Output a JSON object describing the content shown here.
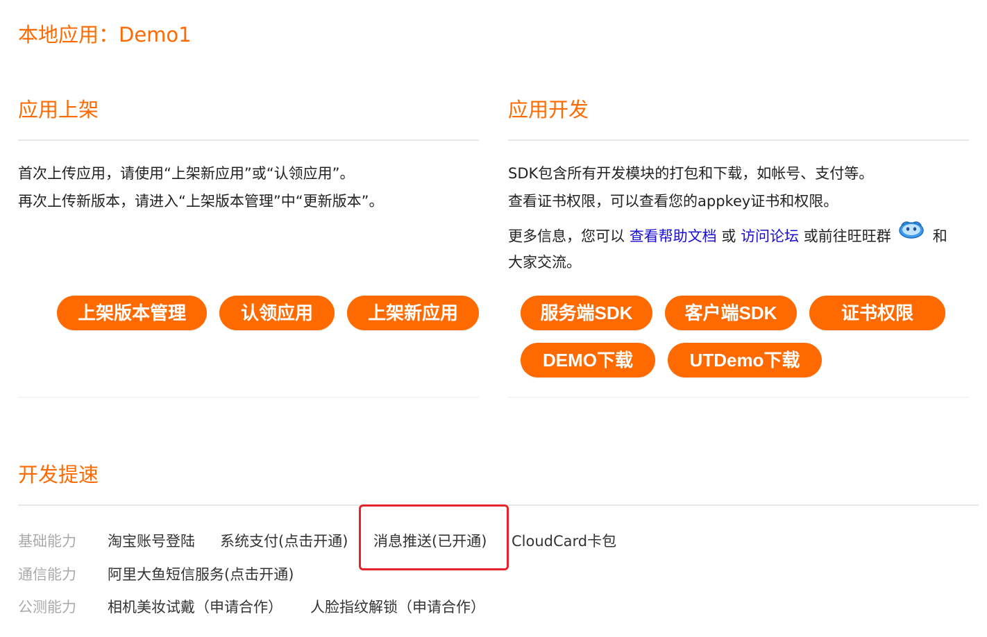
{
  "page": {
    "title": "本地应用：Demo1"
  },
  "listing": {
    "title": "应用上架",
    "line1": "首次上传应用，请使用“上架新应用”或“认领应用”。",
    "line2": "再次上传新版本，请进入“上架版本管理”中“更新版本”。",
    "buttons": [
      "上架版本管理",
      "认领应用",
      "上架新应用"
    ]
  },
  "development": {
    "title": "应用开发",
    "line1": "SDK包含所有开发模块的打包和下载，如帐号、支付等。",
    "line2": "查看证书权限，可以查看您的appkey证书和权限。",
    "more_prefix": "更多信息，您可以",
    "help_link": "查看帮助文档",
    "or_text": "或",
    "forum_link": "访问论坛",
    "wangwang_text": "或前往旺旺群",
    "and_text": "和",
    "line4": "大家交流。",
    "buttons": [
      "服务端SDK",
      "客户端SDK",
      "证书权限",
      "DEMO下载",
      "UTDemo下载"
    ]
  },
  "speedup": {
    "title": "开发提速",
    "rows": [
      {
        "label": "基础能力",
        "items": [
          "淘宝账号登陆",
          "系统支付(点击开通)",
          "消息推送(已开通)",
          "CloudCard卡包"
        ]
      },
      {
        "label": "通信能力",
        "items": [
          "阿里大鱼短信服务(点击开通)"
        ]
      },
      {
        "label": "公测能力",
        "items": [
          "相机美妆试戴（申请合作）",
          "人脸指纹解锁（申请合作）"
        ]
      }
    ]
  },
  "colors": {
    "accent": "#ff6a00",
    "link": "#1a0dd6",
    "highlight": "#e8222a"
  },
  "icons": {
    "wangwang": "wangwang-icon"
  }
}
